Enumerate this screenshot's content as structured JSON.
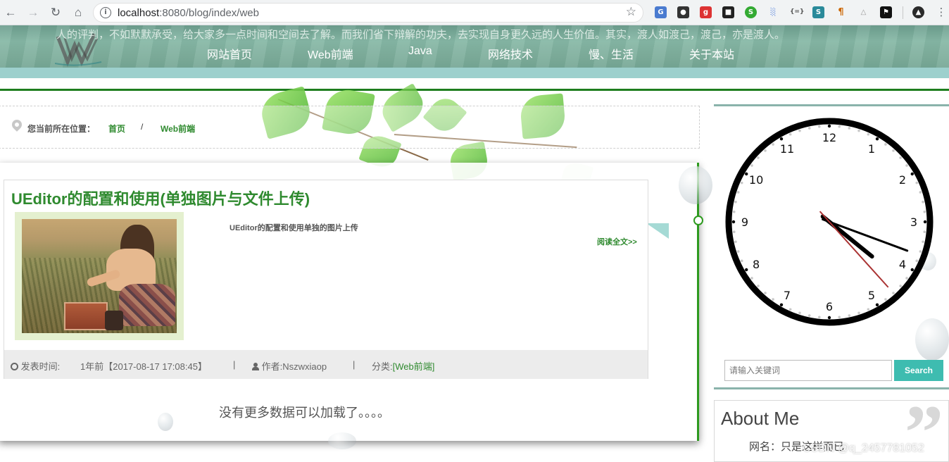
{
  "browser": {
    "url_host": "localhost",
    "url_rest": ":8080/blog/index/web"
  },
  "site": {
    "motto": "人的评判，不如默默承受，给大家多一点时间和空间去了解。而我们省下辩解的功夫，去实现自身更久远的人生价值。其实，渡人如渡己，渡己，亦是渡人。",
    "menu": [
      "网站首页",
      "Web前端",
      "Java",
      "网络技术",
      "慢、生活",
      "关于本站"
    ]
  },
  "breadcrumb": {
    "label": "您当前所在位置：",
    "home": "首页",
    "separator": "/",
    "current": "Web前端"
  },
  "post": {
    "title": "UEditor的配置和使用(单独图片与文件上传)",
    "summary": "UEditor的配置和使用单独的图片上传",
    "read_more": "阅读全文>>",
    "time_label": "发表时间:",
    "time_value": "1年前【2017-08-17 17:08:45】",
    "divider": "|",
    "author": "作者:Nszwxiaop",
    "category_label": "分类:",
    "category": "[Web前端]"
  },
  "no_more": "没有更多数据可以加载了。。。。",
  "clock": {
    "numbers": [
      "12",
      "1",
      "2",
      "3",
      "4",
      "5",
      "6",
      "7",
      "8",
      "9",
      "10",
      "11"
    ],
    "time": "4:18:23"
  },
  "search": {
    "placeholder": "请输入关键词",
    "button": "Search"
  },
  "about": {
    "title": "About Me",
    "nickname": "网名：只是这样而已"
  },
  "watermark": "CSDN @q_2457781052",
  "colors": {
    "accent_green": "#2f8a2f",
    "teal_button": "#3ebcb0"
  }
}
